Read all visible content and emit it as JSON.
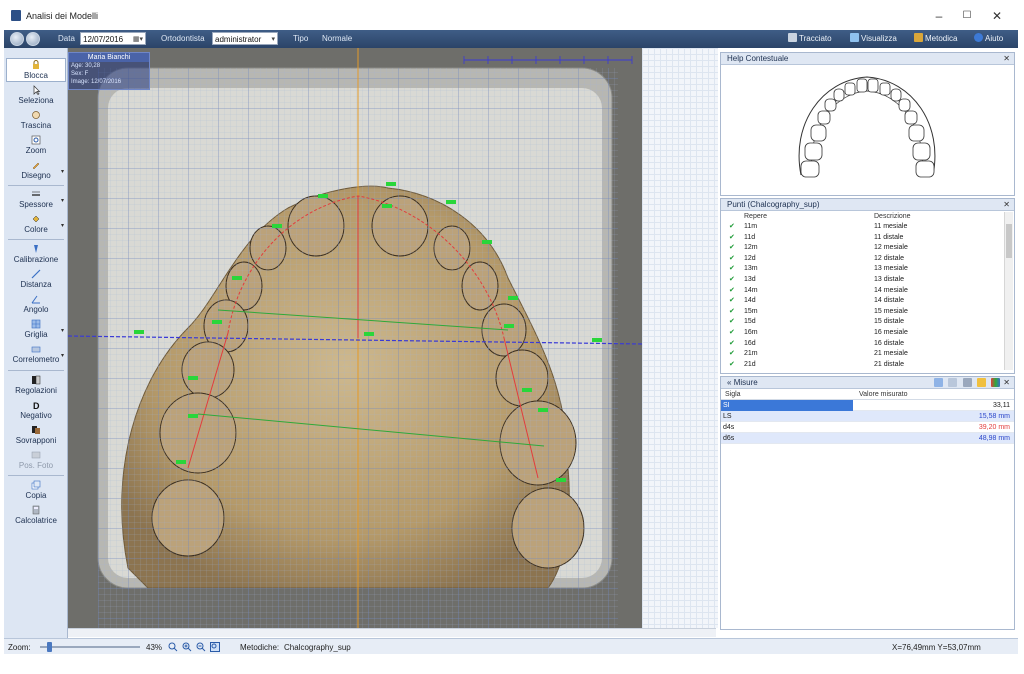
{
  "window": {
    "title": "Analisi dei Modelli",
    "minimize": "–",
    "maximize": "☐",
    "close": "✕"
  },
  "toolbar": {
    "date_label": "Data",
    "date_value": "12/07/2016",
    "orthodontist_label": "Ortodontista",
    "orthodontist_value": "administrator",
    "type_label": "Tipo",
    "type_value": "Normale",
    "right_buttons": [
      "Tracciato",
      "Visualizza",
      "Metodica",
      "Aiuto"
    ]
  },
  "tools": {
    "blocca": "Blocca",
    "seleziona": "Seleziona",
    "trascina": "Trascina",
    "zoom": "Zoom",
    "disegno": "Disegno",
    "spessore": "Spessore",
    "colore": "Colore",
    "calibrazione": "Calibrazione",
    "distanza": "Distanza",
    "angolo": "Angolo",
    "griglia": "Griglia",
    "correlometro": "Correlometro",
    "regolazioni": "Regolazioni",
    "negativo": "Negativo",
    "sovrapponi": "Sovrapponi",
    "pos_foto": "Pos. Foto",
    "copia": "Copia",
    "calcolatrice": "Calcolatrice"
  },
  "patient": {
    "name": "Maria Bianchi",
    "age": "Age: 30,28",
    "sex": "Sex: F",
    "image": "Image: 12/07/2016"
  },
  "help_panel": {
    "title": "Help Contestuale"
  },
  "points_panel": {
    "title": "Punti  (Chalcography_sup)",
    "col_repere": "Repere",
    "col_desc": "Descrizione",
    "rows": [
      {
        "repere": "11m",
        "desc": "11 mesiale"
      },
      {
        "repere": "11d",
        "desc": "11 distale"
      },
      {
        "repere": "12m",
        "desc": "12 mesiale"
      },
      {
        "repere": "12d",
        "desc": "12 distale"
      },
      {
        "repere": "13m",
        "desc": "13 mesiale"
      },
      {
        "repere": "13d",
        "desc": "13 distale"
      },
      {
        "repere": "14m",
        "desc": "14 mesiale"
      },
      {
        "repere": "14d",
        "desc": "14 distale"
      },
      {
        "repere": "15m",
        "desc": "15 mesiale"
      },
      {
        "repere": "15d",
        "desc": "15 distale"
      },
      {
        "repere": "16m",
        "desc": "16 mesiale"
      },
      {
        "repere": "16d",
        "desc": "16 distale"
      },
      {
        "repere": "21m",
        "desc": "21 mesiale"
      },
      {
        "repere": "21d",
        "desc": "21 distale"
      }
    ]
  },
  "measures_panel": {
    "title": "Misure",
    "col_sigla": "Sigla",
    "col_valore": "Valore misurato",
    "rows": [
      {
        "sigla": "SI",
        "valore": "33,11",
        "color": "#1a1a1a"
      },
      {
        "sigla": "LS",
        "valore": "15,58 mm",
        "color": "#2a45c9"
      },
      {
        "sigla": "d4s",
        "valore": "39,20 mm",
        "color": "#e23c3c"
      },
      {
        "sigla": "d6s",
        "valore": "48,98 mm",
        "color": "#2a45c9"
      }
    ]
  },
  "statusbar": {
    "zoom_label": "Zoom:",
    "zoom_value": "43%",
    "method_label": "Metodiche:",
    "method_value": "Chalcography_sup",
    "coords": "X=76,49mm Y=53,07mm"
  },
  "colors": {
    "accent": "#3b78d8",
    "toolbar": "#2b4468",
    "marker": "#29d63a",
    "trace": "#e23c3c"
  }
}
